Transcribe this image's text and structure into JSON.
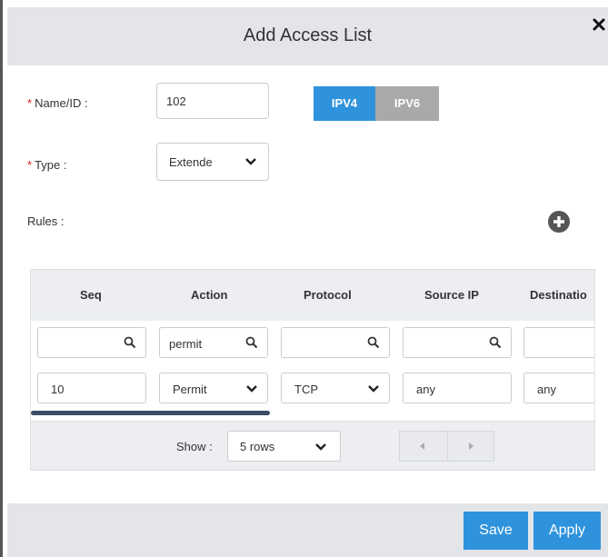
{
  "dialog": {
    "title": "Add Access List"
  },
  "form": {
    "name_label": "Name/ID :",
    "name_value": "102",
    "type_label": "Type :",
    "type_value": "Extende",
    "required_mark": "*",
    "ip_toggle": [
      {
        "label": "IPV4",
        "selected": true
      },
      {
        "label": "IPV6",
        "selected": false
      }
    ],
    "rules_label": "Rules :"
  },
  "grid": {
    "columns": [
      "Seq",
      "Action",
      "Protocol",
      "Source IP",
      "Destinatio"
    ],
    "filters": [
      "",
      "permit",
      "",
      "",
      ""
    ],
    "rows": [
      {
        "seq": "10",
        "action": "Permit",
        "protocol": "TCP",
        "source_ip": "any",
        "destination": "any"
      }
    ],
    "pager": {
      "show_label": "Show :",
      "rows_option": "5 rows"
    }
  },
  "footer": {
    "save_label": "Save",
    "apply_label": "Apply"
  },
  "colors": {
    "primary": "#2e93dc",
    "toggle_off": "#a9a9a9",
    "header_bg": "#e3e5e9"
  }
}
